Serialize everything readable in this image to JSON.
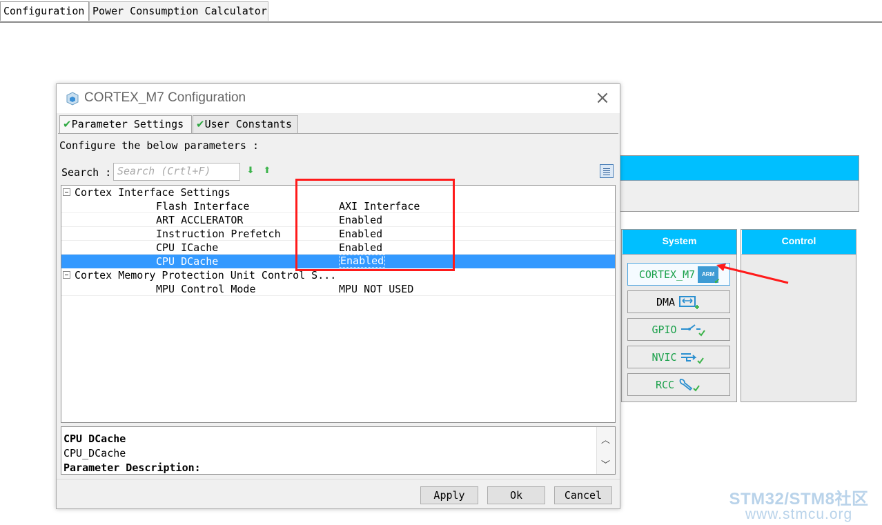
{
  "top_tabs": [
    "Configuration",
    "Power Consumption Calculator"
  ],
  "categories": {
    "system": "System",
    "control": "Control",
    "items": [
      {
        "label": "CORTEX_M7",
        "icon": "arm-chip-icon"
      },
      {
        "label": "DMA",
        "icon": "dma-icon"
      },
      {
        "label": "GPIO",
        "icon": "gpio-icon"
      },
      {
        "label": "NVIC",
        "icon": "nvic-icon"
      },
      {
        "label": "RCC",
        "icon": "wrench-icon"
      }
    ],
    "arm_badge": "ARM"
  },
  "dialog": {
    "title": "CORTEX_M7 Configuration",
    "tabs": [
      "Parameter Settings",
      "User Constants"
    ],
    "configure_text": "Configure the below parameters :",
    "search_label": "Search :",
    "search_placeholder": "Search (Crtl+F)",
    "groups": [
      {
        "name": "Cortex Interface Settings",
        "params": [
          {
            "name": "Flash Interface",
            "value": "AXI Interface"
          },
          {
            "name": "ART ACCLERATOR",
            "value": "Enabled"
          },
          {
            "name": "Instruction Prefetch",
            "value": "Enabled"
          },
          {
            "name": "CPU ICache",
            "value": "Enabled"
          },
          {
            "name": "CPU DCache",
            "value": "Enabled",
            "selected": true
          }
        ]
      },
      {
        "name": "Cortex Memory Protection Unit Control S...",
        "params": [
          {
            "name": "MPU Control Mode",
            "value": "MPU NOT USED"
          }
        ]
      }
    ],
    "description": {
      "title": "CPU DCache",
      "id": "CPU_DCache",
      "heading": "Parameter Description:"
    },
    "buttons": {
      "apply": "Apply",
      "ok": "Ok",
      "cancel": "Cancel"
    }
  },
  "watermark": {
    "line1": "STM32/STM8社区",
    "line2": "www.stmcu.org"
  },
  "colors": {
    "accent": "#00bfff",
    "selection": "#3399ff",
    "annotation": "#ff1a1a",
    "ok_green": "#3bb34a"
  }
}
